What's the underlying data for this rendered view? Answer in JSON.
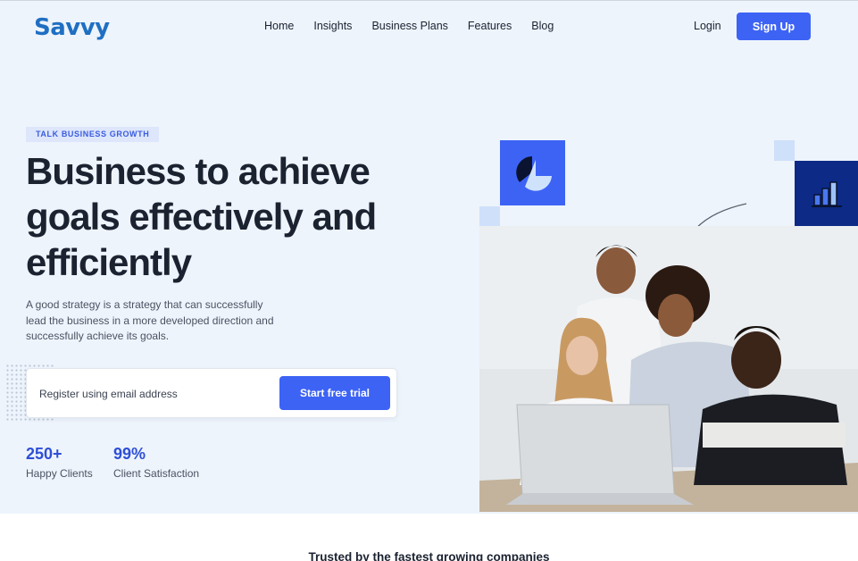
{
  "header": {
    "logo": "Savvy",
    "nav": [
      "Home",
      "Insights",
      "Business Plans",
      "Features",
      "Blog"
    ],
    "login": "Login",
    "signup": "Sign Up"
  },
  "hero": {
    "tag": "TALK BUSINESS GROWTH",
    "headline_lines": [
      "Business to achieve",
      "goals effectively and",
      "efficiently"
    ],
    "description": "A good strategy is a strategy that can successfully lead the business in a more developed direction and successfully achieve its goals.",
    "form": {
      "placeholder": "Register using email address",
      "button": "Start free trial"
    },
    "stats": [
      {
        "value": "250+",
        "label": "Happy Clients"
      },
      {
        "value": "99%",
        "label": "Client Satisfaction"
      }
    ]
  },
  "icons": {
    "pie": "pie-chart-icon",
    "bars": "bar-chart-icon"
  },
  "colors": {
    "accent": "#3d63f5",
    "navy": "#0d2a86",
    "hero_bg": "#eef4fc",
    "logo": "#1f6fc2"
  },
  "footer_teaser": "Trusted by the fastest growing companies"
}
